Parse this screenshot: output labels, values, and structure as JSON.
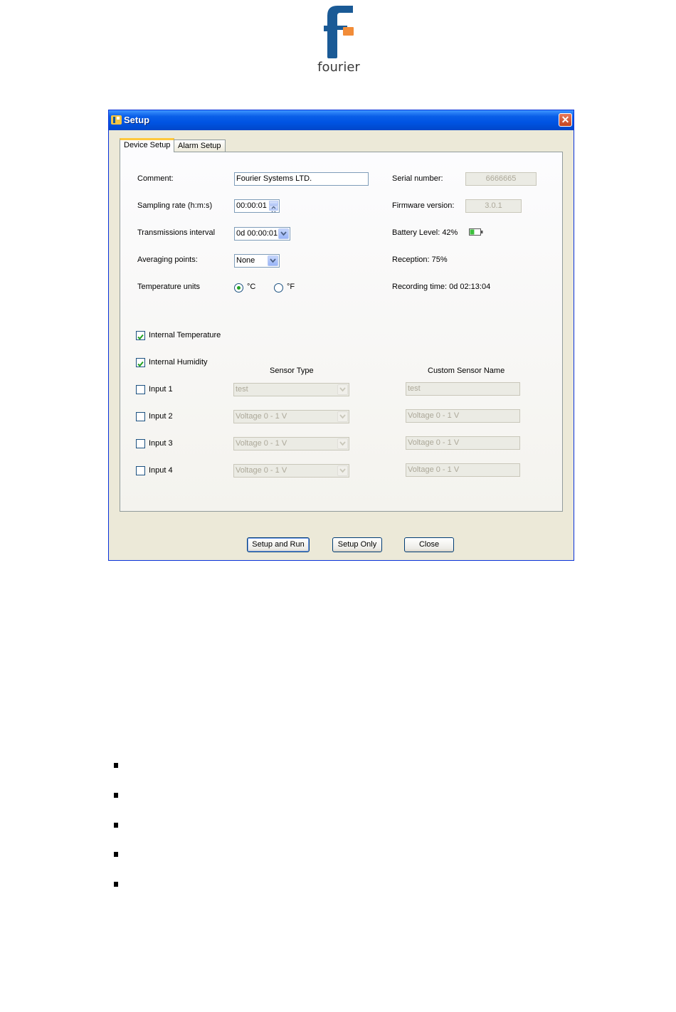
{
  "logo": {
    "text": "fourier"
  },
  "window": {
    "title": "Setup",
    "close_glyph": "✕"
  },
  "tabs": [
    {
      "label": "Device Setup",
      "active": true
    },
    {
      "label": "Alarm Setup",
      "active": false
    }
  ],
  "left_fields": {
    "comment_label": "Comment:",
    "comment_value": "Fourier Systems LTD.",
    "sampling_label": "Sampling rate (h:m:s)",
    "sampling_value": "00:00:01",
    "transmission_label": "Transmissions interval",
    "transmission_value": "0d 00:00:01",
    "averaging_label": "Averaging points:",
    "averaging_value": "None",
    "temp_units_label": "Temperature units",
    "unit_c": "°C",
    "unit_f": "°F",
    "selected_unit": "°C"
  },
  "right_info": {
    "serial_label": "Serial number:",
    "serial_value": "6666665",
    "firmware_label": "Firmware version:",
    "firmware_value": "3.0.1",
    "battery_text": "Battery Level: 42%",
    "battery_percent": 42,
    "reception_text": "Reception: 75%",
    "recording_text": "Recording time: 0d 02:13:04"
  },
  "sensors": {
    "internal_temperature": {
      "label": "Internal Temperature",
      "checked": true
    },
    "internal_humidity": {
      "label": "Internal Humidity",
      "checked": true
    },
    "sensor_type_header": "Sensor Type",
    "custom_name_header": "Custom Sensor Name",
    "inputs": [
      {
        "label": "Input 1",
        "checked": false,
        "type": "test",
        "name": "test"
      },
      {
        "label": "Input 2",
        "checked": false,
        "type": "Voltage 0 - 1 V",
        "name": "Voltage 0 - 1 V"
      },
      {
        "label": "Input 3",
        "checked": false,
        "type": "Voltage 0 - 1 V",
        "name": "Voltage 0 - 1 V"
      },
      {
        "label": "Input 4",
        "checked": false,
        "type": "Voltage 0 - 1 V",
        "name": "Voltage 0 - 1 V"
      }
    ]
  },
  "buttons": {
    "setup_run": "Setup and Run",
    "setup_only": "Setup Only",
    "close": "Close"
  },
  "colors": {
    "title_bar": "#0054e3",
    "logo_blue": "#1a5a96",
    "logo_orange": "#f28c38",
    "battery_green": "#3cbf3c",
    "checkmark": "#21a121"
  }
}
